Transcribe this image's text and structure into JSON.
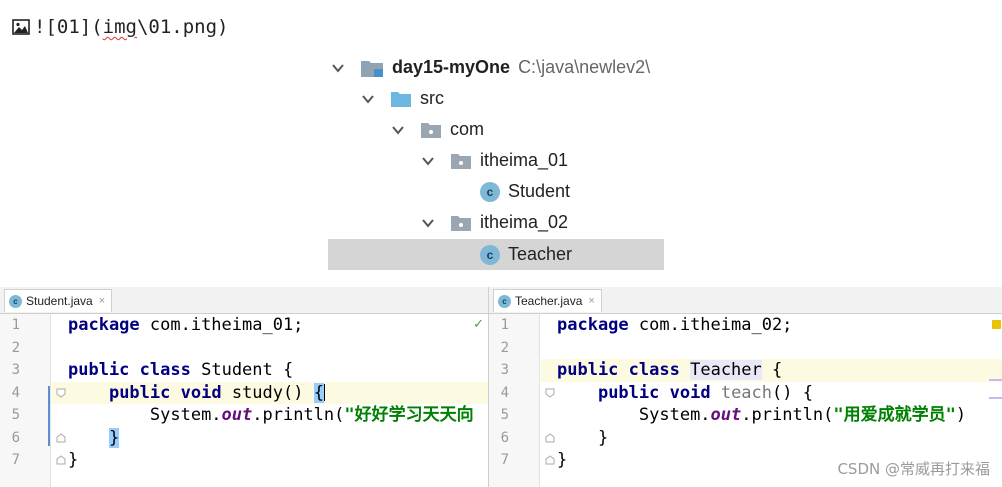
{
  "markdown": {
    "text_prefix": "![01](",
    "text_link": "img",
    "text_suffix": "\\01.png)"
  },
  "tree": {
    "project": {
      "name": "day15-myOne",
      "path": "C:\\java\\newlev2\\"
    },
    "src": "src",
    "com": "com",
    "pkg1": "itheima_01",
    "class1": "Student",
    "pkg2": "itheima_02",
    "class2": "Teacher"
  },
  "editor_left": {
    "tab_label": "Student.java",
    "tab_icon_letter": "c",
    "line_numbers": [
      "1",
      "2",
      "3",
      "4",
      "5",
      "6",
      "7"
    ],
    "l1_kw": "package",
    "l1_rest": " com.itheima_01;",
    "l3_kw1": "public",
    "l3_kw2": "class",
    "l3_name": "Student",
    "l3_brace": " {",
    "l4_kw1": "public",
    "l4_kw2": "void",
    "l4_name": "study()",
    "l4_brace": "{",
    "l5_pre": "System.",
    "l5_field": "out",
    "l5_mid": ".println(",
    "l5_str": "\"好好学习天天向",
    "l6_brace": "}",
    "l7_brace": "}"
  },
  "editor_right": {
    "tab_label": "Teacher.java",
    "tab_icon_letter": "c",
    "line_numbers": [
      "1",
      "2",
      "3",
      "4",
      "5",
      "6",
      "7"
    ],
    "l1_kw": "package",
    "l1_rest": " com.itheima_02;",
    "l3_kw1": "public",
    "l3_kw2": "class",
    "l3_name": "Teacher",
    "l3_brace": " {",
    "l4_kw1": "public",
    "l4_kw2": "void",
    "l4_name": "teach",
    "l4_rest": "() {",
    "l5_pre": "System.",
    "l5_field": "out",
    "l5_mid": ".println(",
    "l5_str": "\"用爱成就学员\"",
    "l5_end": ")",
    "l6_brace": "}",
    "l7_brace": "}"
  },
  "tab_close_glyph": "×",
  "check_glyph": "✓",
  "watermark": "CSDN @常威再打来福",
  "colors": {
    "keyword": "#000080",
    "string": "#008000",
    "field": "#660e7a",
    "folder": "#8fa3b3",
    "src_folder": "#6cb6e0",
    "class_icon": "#7fb8d6"
  }
}
